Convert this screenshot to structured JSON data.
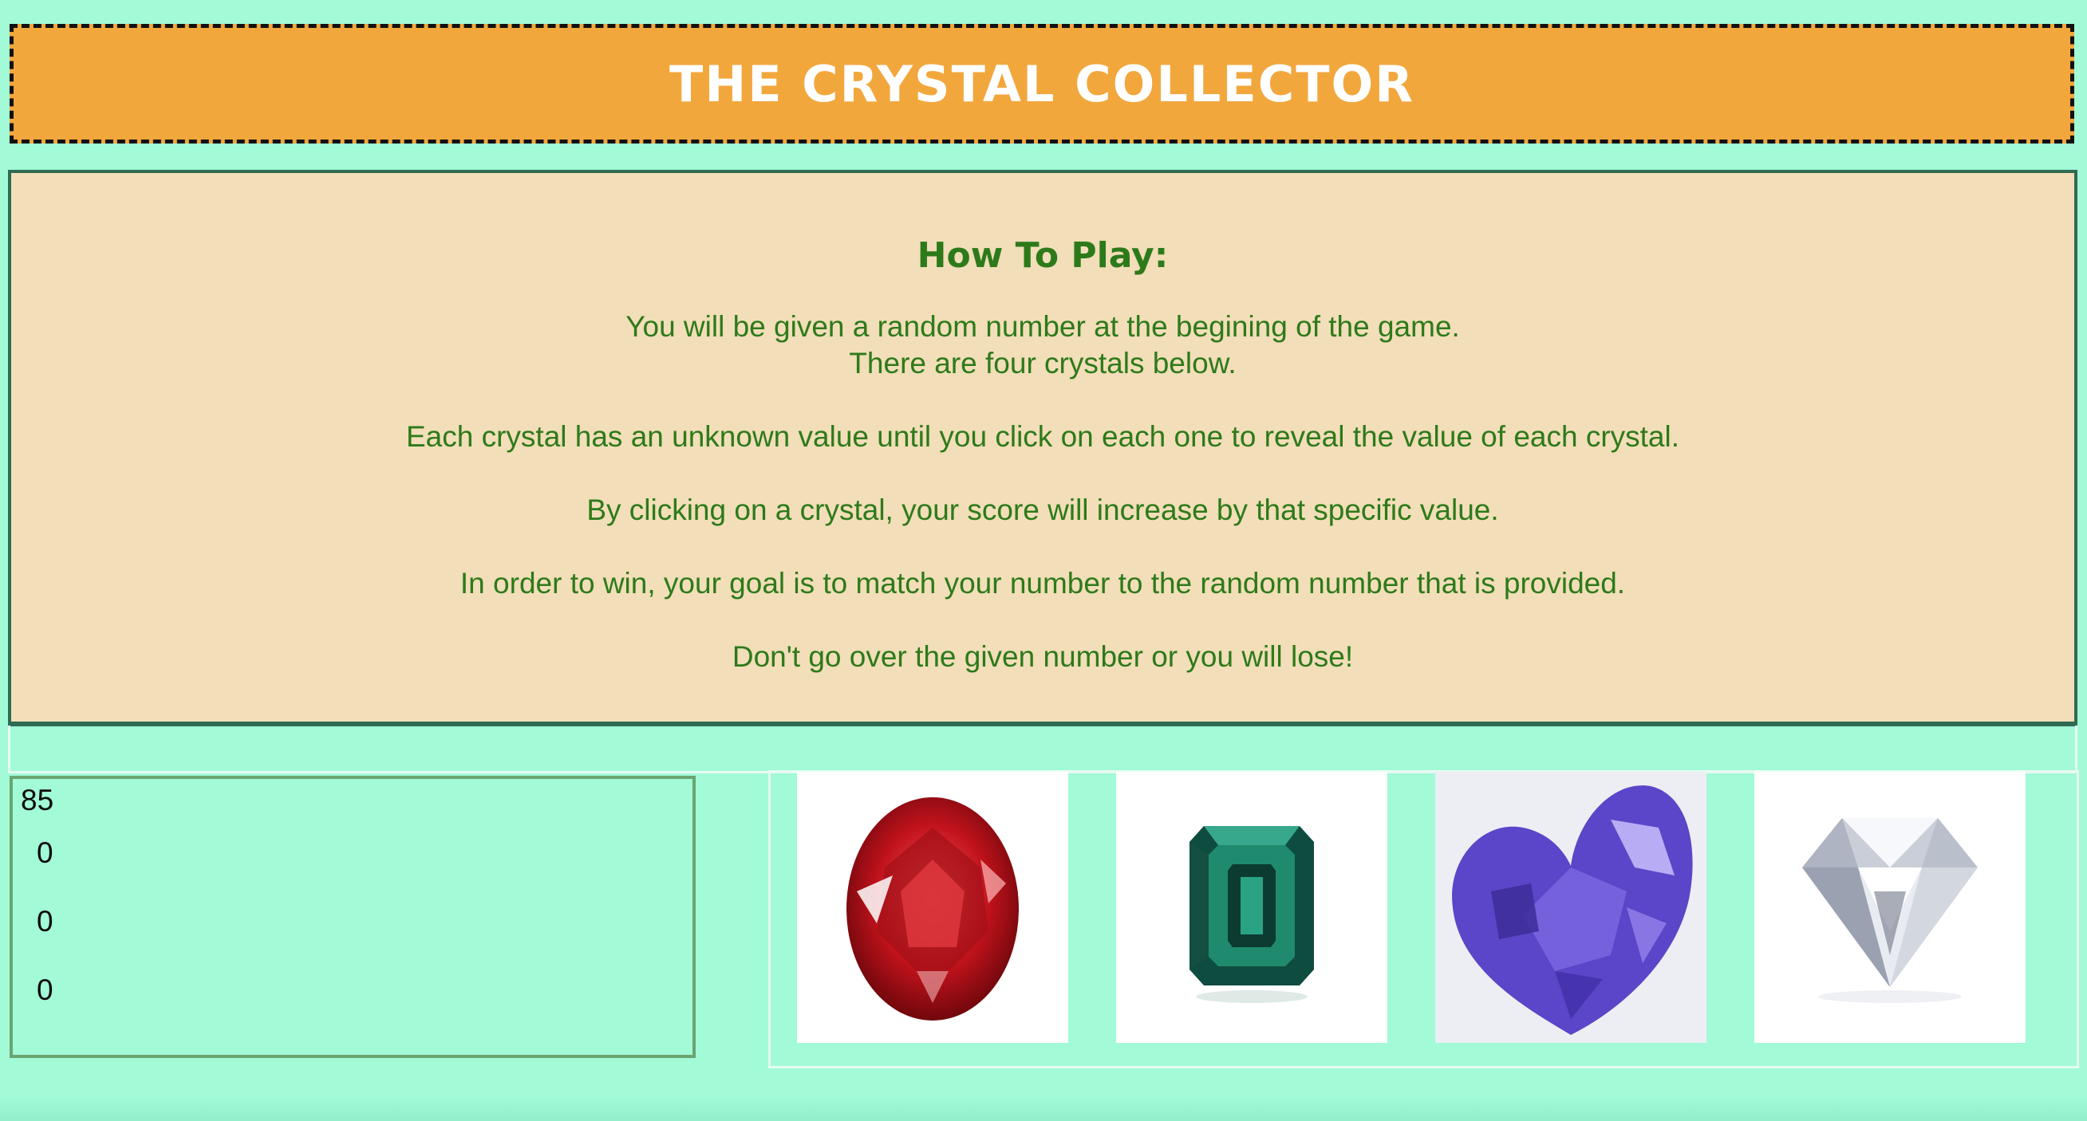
{
  "header": {
    "title": "THE CRYSTAL COLLECTOR"
  },
  "instructions": {
    "heading": "How To Play:",
    "lines": [
      "You will be given a random number at the begining of the game.",
      "There are four crystals below.",
      "Each crystal has an unknown value until you click on each one to reveal the value of each crystal.",
      "By clicking on a crystal, your score will increase by that specific value.",
      "In order to win, your goal is to match your number to the random number that is provided.",
      "Don't go over the given number or you will lose!"
    ]
  },
  "scoreboard": {
    "random_number": "85",
    "values": [
      "0",
      "0",
      "0"
    ]
  },
  "crystals": [
    {
      "name": "red-ruby",
      "color": "#b0141e"
    },
    {
      "name": "green-emerald",
      "color": "#1d6b58"
    },
    {
      "name": "purple-amethyst",
      "color": "#5a3fc2"
    },
    {
      "name": "clear-diamond",
      "color": "#d8dce4"
    }
  ],
  "colors": {
    "background": "#a2fad7",
    "header": "#f2a73d",
    "instructions_bg": "#f2deb8",
    "instructions_text": "#2d7a1a"
  }
}
